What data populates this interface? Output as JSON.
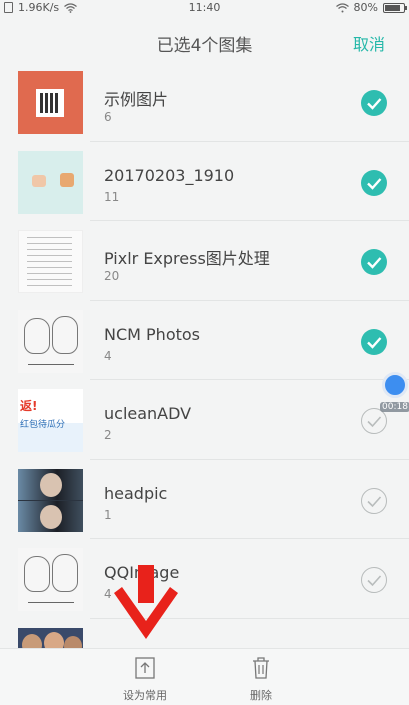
{
  "status_bar": {
    "speed": "1.96K/s",
    "time": "11:40",
    "battery": "80%"
  },
  "header": {
    "title": "已选4个图集",
    "cancel_label": "取消"
  },
  "albums": [
    {
      "name": "示例图片",
      "count": "6",
      "selected": true,
      "thumb": "red-qr"
    },
    {
      "name": "20170203_1910",
      "count": "11",
      "selected": true,
      "thumb": "mint"
    },
    {
      "name": "Pixlr Express图片处理",
      "count": "20",
      "selected": true,
      "thumb": "paper"
    },
    {
      "name": "NCM Photos",
      "count": "4",
      "selected": true,
      "thumb": "sketch"
    },
    {
      "name": "ucleanADV",
      "count": "2",
      "selected": false,
      "thumb": "ad"
    },
    {
      "name": "headpic",
      "count": "1",
      "selected": false,
      "thumb": "photo"
    },
    {
      "name": "QQImage",
      "count": "4",
      "selected": false,
      "thumb": "sketch"
    },
    {
      "name": "",
      "count": "",
      "selected": false,
      "thumb": "people"
    }
  ],
  "thumb_text": {
    "ad_line1": "返!",
    "ad_line2": "红包待瓜分"
  },
  "recorder": {
    "time": "00:18"
  },
  "bottom_bar": {
    "set_common_label": "设为常用",
    "delete_label": "删除"
  },
  "colors": {
    "accent": "#2ebdb0",
    "cancel": "#26b8a9",
    "arrow": "#e8221b",
    "recorder": "#3d8ef0"
  },
  "icons": [
    "wifi-icon",
    "battery-icon",
    "check-icon",
    "set-common-icon",
    "trash-icon",
    "down-arrow-icon"
  ]
}
